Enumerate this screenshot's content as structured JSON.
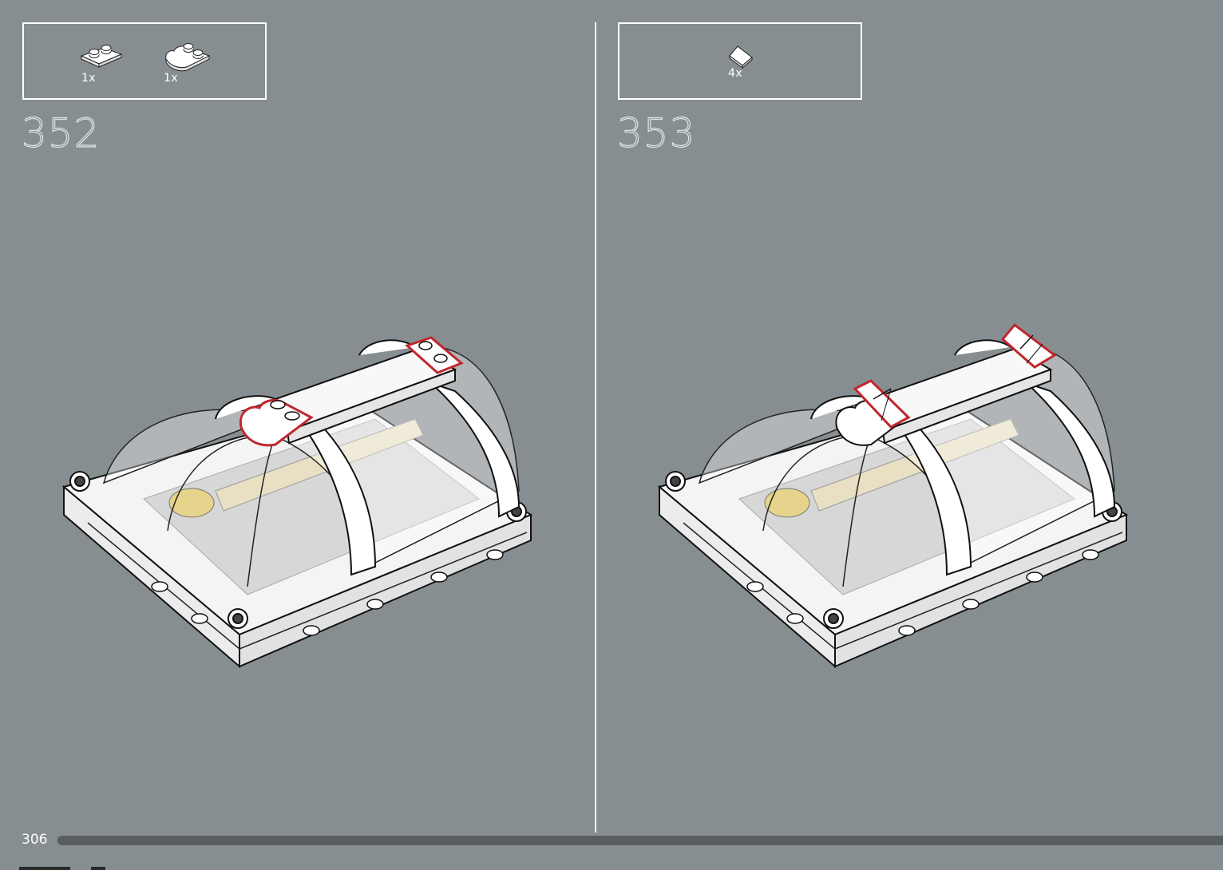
{
  "page": {
    "number": "306",
    "progress": 1.0
  },
  "steps": [
    {
      "number": "352",
      "parts": [
        {
          "qty": "1x",
          "icon": "plate-1x2-white-icon"
        },
        {
          "qty": "1x",
          "icon": "wing-plate-white-icon"
        }
      ]
    },
    {
      "number": "353",
      "parts": [
        {
          "qty": "4x",
          "icon": "slope-tile-white-icon"
        }
      ]
    }
  ],
  "colors": {
    "background": "#878e91",
    "highlight": "#c0272d",
    "part": "#ffffff",
    "divider": "#ffffff"
  }
}
